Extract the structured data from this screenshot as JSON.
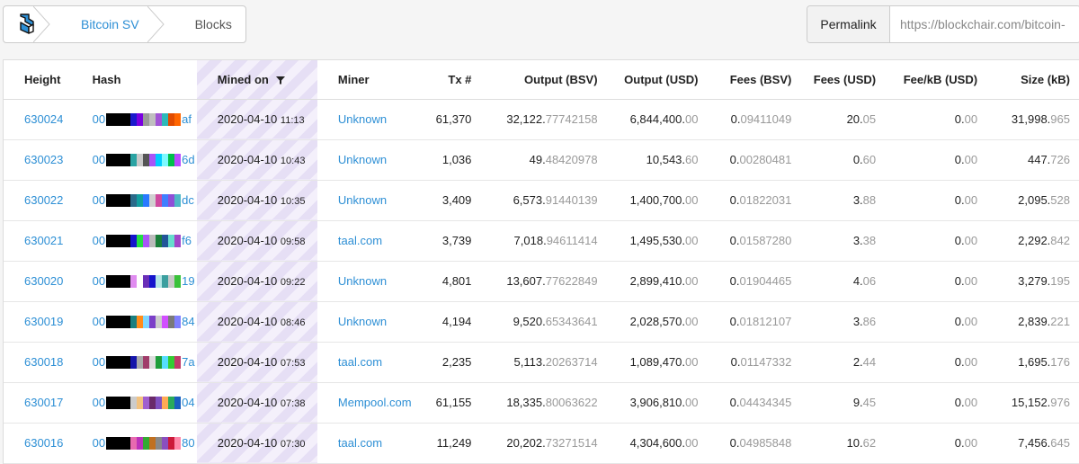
{
  "breadcrumb": {
    "items": [
      "Bitcoin SV",
      "Blocks"
    ]
  },
  "permalink": {
    "label": "Permalink",
    "value": "https://blockchair.com/bitcoin-"
  },
  "table": {
    "columns": [
      "Height",
      "Hash",
      "Mined on",
      "Miner",
      "Tx #",
      "Output (BSV)",
      "Output (USD)",
      "Fees (BSV)",
      "Fees (USD)",
      "Fee/kB (USD)",
      "Size (kB)"
    ],
    "rows": [
      {
        "height": "630024",
        "hash_prefix": "00",
        "hash_colors": [
          "#000",
          "#000",
          "#1a1acc",
          "#7a00e0",
          "#999",
          "#bfbfbf",
          "#a255d6",
          "#2cb9b9",
          "#e04b00",
          "#ff6600"
        ],
        "hash_suffix": "af",
        "date": "2020-04-10",
        "time": "11:13",
        "miner": "Unknown",
        "tx": "61,370",
        "out_bsv_int": "32,122.",
        "out_bsv_dec": "77742158",
        "out_usd_int": "6,844,400.",
        "out_usd_dec": "00",
        "fees_bsv_int": "0.",
        "fees_bsv_dec": "09411049",
        "fees_usd_int": "20.",
        "fees_usd_dec": "05",
        "fee_kb_int": "0.",
        "fee_kb_dec": "00",
        "size_int": "31,998.",
        "size_dec": "965"
      },
      {
        "height": "630023",
        "hash_prefix": "00",
        "hash_colors": [
          "#000",
          "#000",
          "#2aa3a3",
          "#c9c9c9",
          "#555",
          "#a855f7",
          "#00ccff",
          "#7df9ff",
          "#00c04a",
          "#b84bff"
        ],
        "hash_suffix": "6d",
        "date": "2020-04-10",
        "time": "10:43",
        "miner": "Unknown",
        "tx": "1,036",
        "out_bsv_int": "49.",
        "out_bsv_dec": "48420978",
        "out_usd_int": "10,543.",
        "out_usd_dec": "60",
        "fees_bsv_int": "0.",
        "fees_bsv_dec": "00280481",
        "fees_usd_int": "0.",
        "fees_usd_dec": "60",
        "fee_kb_int": "0.",
        "fee_kb_dec": "00",
        "size_int": "447.",
        "size_dec": "726"
      },
      {
        "height": "630022",
        "hash_prefix": "00",
        "hash_colors": [
          "#000",
          "#000",
          "#2a6a8a",
          "#129ea0",
          "#2979ff",
          "#d0d0d0",
          "#cf4aa0",
          "#3f7fff",
          "#8f4fd7",
          "#4fb7c7"
        ],
        "hash_suffix": "dc",
        "date": "2020-04-10",
        "time": "10:35",
        "miner": "Unknown",
        "tx": "3,409",
        "out_bsv_int": "6,573.",
        "out_bsv_dec": "91440139",
        "out_usd_int": "1,400,700.",
        "out_usd_dec": "00",
        "fees_bsv_int": "0.",
        "fees_bsv_dec": "01822031",
        "fees_usd_int": "3.",
        "fees_usd_dec": "88",
        "fee_kb_int": "0.",
        "fee_kb_dec": "00",
        "size_int": "2,095.",
        "size_dec": "528"
      },
      {
        "height": "630021",
        "hash_prefix": "00",
        "hash_colors": [
          "#000",
          "#000",
          "#1515cc",
          "#22dd44",
          "#a855f7",
          "#bbbbbb",
          "#1a7f3a",
          "#225599",
          "#66ddcc",
          "#a048c8"
        ],
        "hash_suffix": "f6",
        "date": "2020-04-10",
        "time": "09:58",
        "miner": "taal.com",
        "tx": "3,739",
        "out_bsv_int": "7,018.",
        "out_bsv_dec": "94611414",
        "out_usd_int": "1,495,530.",
        "out_usd_dec": "00",
        "fees_bsv_int": "0.",
        "fees_bsv_dec": "01587280",
        "fees_usd_int": "3.",
        "fees_usd_dec": "38",
        "fee_kb_int": "0.",
        "fee_kb_dec": "00",
        "size_int": "2,292.",
        "size_dec": "842"
      },
      {
        "height": "630020",
        "hash_prefix": "00",
        "hash_colors": [
          "#000",
          "#000",
          "#e08cf0",
          "#ffffff",
          "#6a2fb8",
          "#1515cc",
          "#b5e6e6",
          "#3b9f9f",
          "#c8c8c8",
          "#3ac23a"
        ],
        "hash_suffix": "19",
        "date": "2020-04-10",
        "time": "09:22",
        "miner": "Unknown",
        "tx": "4,801",
        "out_bsv_int": "13,607.",
        "out_bsv_dec": "77622849",
        "out_usd_int": "2,899,410.",
        "out_usd_dec": "00",
        "fees_bsv_int": "0.",
        "fees_bsv_dec": "01904465",
        "fees_usd_int": "4.",
        "fees_usd_dec": "06",
        "fee_kb_int": "0.",
        "fee_kb_dec": "00",
        "size_int": "3,279.",
        "size_dec": "195"
      },
      {
        "height": "630019",
        "hash_prefix": "00",
        "hash_colors": [
          "#000",
          "#000",
          "#1a7f7f",
          "#ff8c1a",
          "#7fd7ff",
          "#7b3fc8",
          "#cccccc",
          "#d14fff",
          "#7a7a7a",
          "#8080ff"
        ],
        "hash_suffix": "84",
        "date": "2020-04-10",
        "time": "08:46",
        "miner": "Unknown",
        "tx": "4,194",
        "out_bsv_int": "9,520.",
        "out_bsv_dec": "65343641",
        "out_usd_int": "2,028,570.",
        "out_usd_dec": "00",
        "fees_bsv_int": "0.",
        "fees_bsv_dec": "01812107",
        "fees_usd_int": "3.",
        "fees_usd_dec": "86",
        "fee_kb_int": "0.",
        "fee_kb_dec": "00",
        "size_int": "2,839.",
        "size_dec": "221"
      },
      {
        "height": "630018",
        "hash_prefix": "00",
        "hash_colors": [
          "#000",
          "#000",
          "#1515aa",
          "#aaaaaa",
          "#a03c6a",
          "#dddddd",
          "#1e9e3a",
          "#55ddff",
          "#33cc33",
          "#c03a6a"
        ],
        "hash_suffix": "7a",
        "date": "2020-04-10",
        "time": "07:53",
        "miner": "taal.com",
        "tx": "2,235",
        "out_bsv_int": "5,113.",
        "out_bsv_dec": "20263714",
        "out_usd_int": "1,089,470.",
        "out_usd_dec": "00",
        "fees_bsv_int": "0.",
        "fees_bsv_dec": "01147332",
        "fees_usd_int": "2.",
        "fees_usd_dec": "44",
        "fee_kb_int": "0.",
        "fee_kb_dec": "00",
        "size_int": "1,695.",
        "size_dec": "176"
      },
      {
        "height": "630017",
        "hash_prefix": "00",
        "hash_colors": [
          "#000",
          "#000",
          "#cccccc",
          "#f2c280",
          "#a05fcf",
          "#6a2a6a",
          "#7f4fbf",
          "#ffaa55",
          "#2aaa5a",
          "#1a5fbf"
        ],
        "hash_suffix": "04",
        "date": "2020-04-10",
        "time": "07:38",
        "miner": "Mempool.com",
        "tx": "61,155",
        "out_bsv_int": "18,335.",
        "out_bsv_dec": "80063622",
        "out_usd_int": "3,906,810.",
        "out_usd_dec": "00",
        "fees_bsv_int": "0.",
        "fees_bsv_dec": "04434345",
        "fees_usd_int": "9.",
        "fees_usd_dec": "45",
        "fee_kb_int": "0.",
        "fee_kb_dec": "00",
        "size_int": "15,152.",
        "size_dec": "976"
      },
      {
        "height": "630016",
        "hash_prefix": "00",
        "hash_colors": [
          "#000",
          "#000",
          "#e86ab0",
          "#bb33bb",
          "#33aa33",
          "#c07020",
          "#888888",
          "#8a4fbf",
          "#cc1a3a",
          "#ff88aa"
        ],
        "hash_suffix": "80",
        "date": "2020-04-10",
        "time": "07:30",
        "miner": "taal.com",
        "tx": "11,249",
        "out_bsv_int": "20,202.",
        "out_bsv_dec": "73271514",
        "out_usd_int": "4,304,600.",
        "out_usd_dec": "00",
        "fees_bsv_int": "0.",
        "fees_bsv_dec": "04985848",
        "fees_usd_int": "10.",
        "fees_usd_dec": "62",
        "fee_kb_int": "0.",
        "fee_kb_dec": "00",
        "size_int": "7,456.",
        "size_dec": "645"
      }
    ]
  },
  "colors": {
    "link": "#2d8fd5",
    "dim": "#999999",
    "stripe_light": "#f4f0fb",
    "stripe_dark": "#e6dff5"
  },
  "icons": {
    "logo": "blockchair-logo-icon",
    "filter": "filter-icon",
    "chevron": "chevron-right-icon"
  }
}
